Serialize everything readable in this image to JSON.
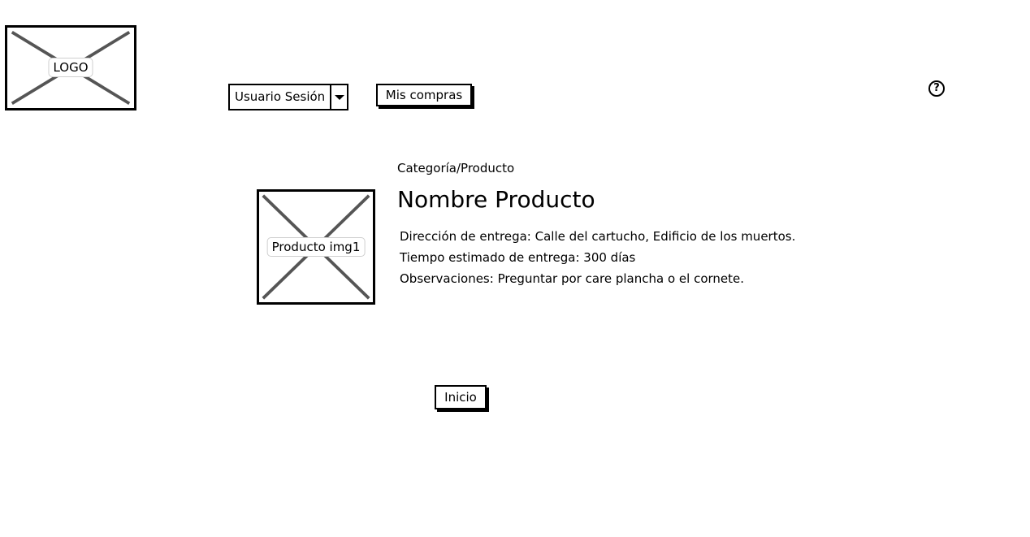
{
  "header": {
    "logo_label": "LOGO",
    "user_dropdown": {
      "selected": "Usuario Sesión"
    },
    "purchases_button": "Mis compras",
    "help_icon": "?"
  },
  "product": {
    "breadcrumb": "Categoría/Producto",
    "name": "Nombre Producto",
    "image_label": "Producto img1",
    "details": [
      "Dirección de entrega: Calle del cartucho, Edificio de los muertos.",
      "Tiempo estimado de entrega: 300 días",
      "Observaciones: Preguntar por care plancha o el cornete."
    ]
  },
  "footer": {
    "home_button": "Inicio"
  }
}
